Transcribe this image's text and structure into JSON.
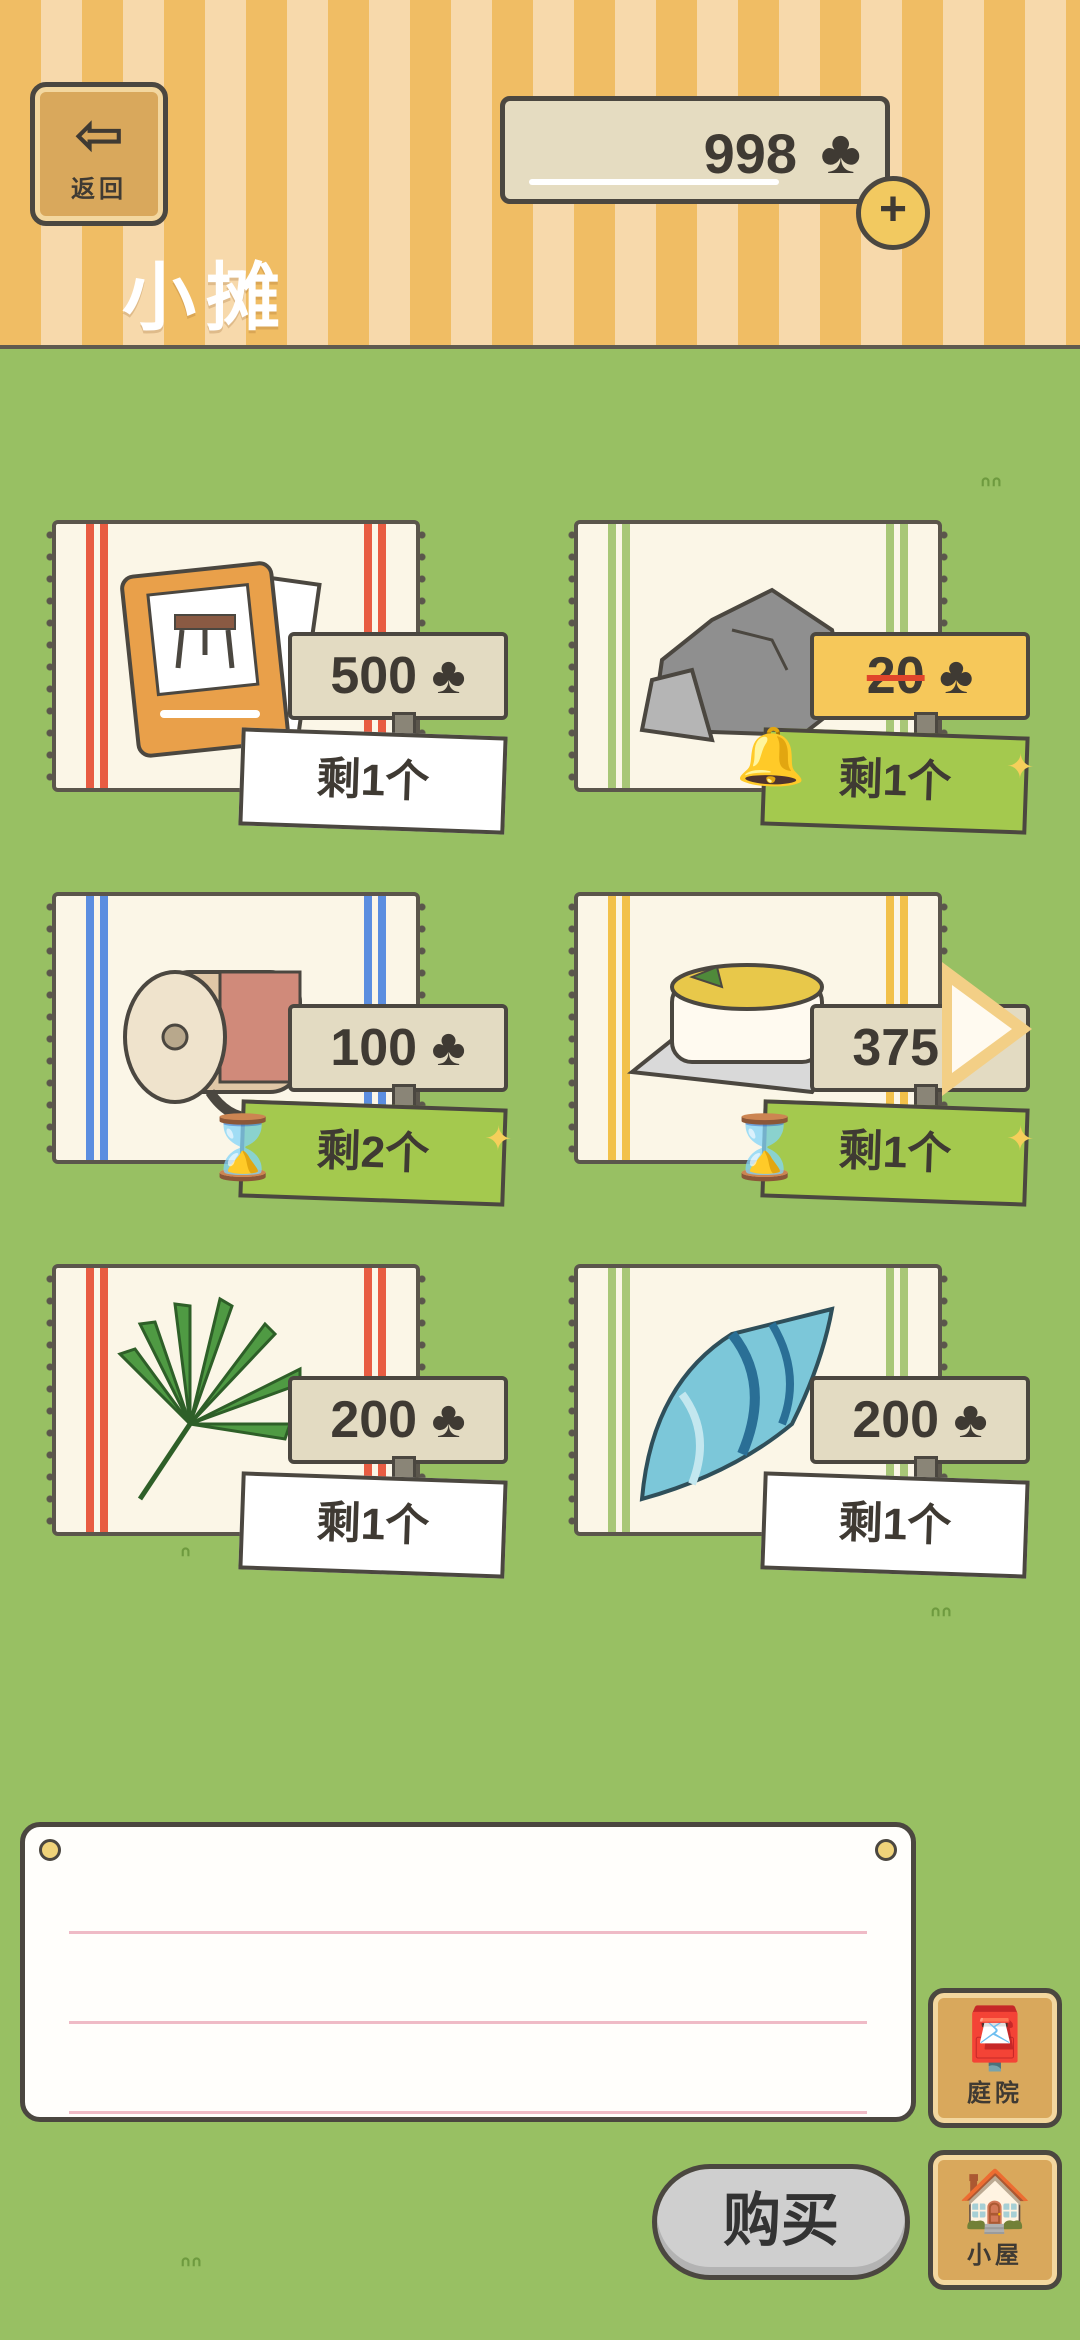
{
  "header": {
    "back_label": "返回",
    "back_icon": "arrow-left-icon",
    "title": "小摊",
    "coins": "998",
    "coin_symbol": "♣",
    "plus_symbol": "+"
  },
  "items": [
    {
      "name": "table-card",
      "price": "500",
      "stock": "剩1个",
      "stripe": "#e85c42",
      "on_sale": false,
      "timed": false
    },
    {
      "name": "rock",
      "price": "20",
      "stock": "剩1个",
      "stripe": "#a8c777",
      "on_sale": true,
      "timed": false
    },
    {
      "name": "wood-log-roll",
      "price": "100",
      "stock": "剩2个",
      "stripe": "#5b8ee0",
      "on_sale": false,
      "timed": true
    },
    {
      "name": "gratin-dish",
      "price": "375",
      "stock": "剩1个",
      "stripe": "#f2c14a",
      "on_sale": false,
      "timed": true
    },
    {
      "name": "palm-leaf",
      "price": "200",
      "stock": "剩1个",
      "stripe": "#e85c42",
      "on_sale": false,
      "timed": false
    },
    {
      "name": "seashell",
      "price": "200",
      "stock": "剩1个",
      "stripe": "#a8c777",
      "on_sale": false,
      "timed": false
    }
  ],
  "buttons": {
    "buy": "购买",
    "yard": "庭院",
    "house": "小屋"
  },
  "colors": {
    "grass": "#98c063",
    "header_stripe_a": "#f0bd64",
    "header_stripe_b": "#f7d9ab",
    "sale_tag": "#f6c85a",
    "stock_green": "#a4c94e"
  }
}
